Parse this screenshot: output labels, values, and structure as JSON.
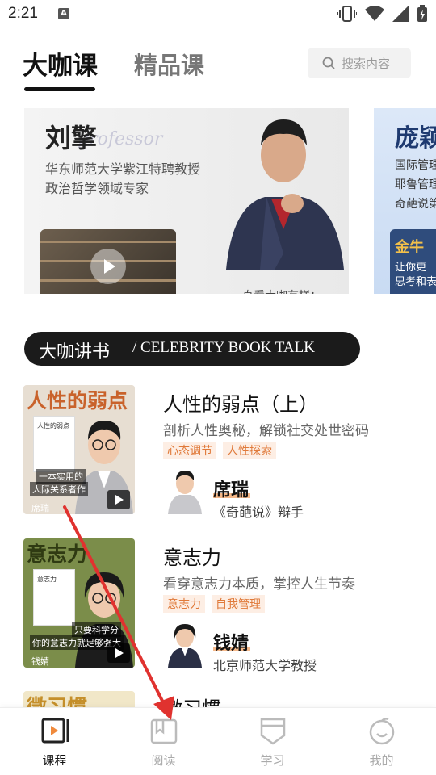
{
  "status_bar": {
    "time": "2:21",
    "notification_letter": "A"
  },
  "top_tabs": {
    "active_tab": "大咖课",
    "second_tab": "精品课",
    "search_placeholder": "搜索内容"
  },
  "banner_main": {
    "name": "刘擎",
    "watermark": "professor",
    "line1": "华东师范大学紫江特聘教授",
    "line2": "政治哲学领域专家",
    "caption": "直看大咖有样："
  },
  "banner_next": {
    "name": "庞颖",
    "line1": "国际管理",
    "line2": "耶鲁管理",
    "line3": "奇葩说第",
    "thumb_title": "金牛",
    "thumb_line1": "让你更",
    "thumb_line2": "思考和表"
  },
  "section": {
    "title_cn": "大咖讲书",
    "title_en": "/ CELEBRITY BOOK TALK"
  },
  "books": [
    {
      "cover_title": "人性的弱点",
      "cover_book_text": "人性的弱点",
      "cover_banner1": "一本实用的",
      "cover_banner2": "人际关系者作",
      "cover_author": "席瑞",
      "title": "人性的弱点（上）",
      "desc": "剖析人性奥秘，解锁社交处世密码",
      "tags": [
        "心态调节",
        "人性探索"
      ],
      "author": "席瑞",
      "role": "《奇葩说》辩手"
    },
    {
      "cover_title": "意志力",
      "cover_book_text": "意志力",
      "cover_banner1": "只要科学分",
      "cover_banner2": "你的意志力就足够强大",
      "cover_author": "钱婧",
      "title": "意志力",
      "desc": "看穿意志力本质，掌控人生节奏",
      "tags": [
        "意志力",
        "自我管理"
      ],
      "author": "钱婧",
      "role": "北京师范大学教授"
    },
    {
      "cover_title": "微习惯",
      "title": "微习惯"
    }
  ],
  "bottom_nav": [
    {
      "label": "课程",
      "icon": "course-icon",
      "active": true
    },
    {
      "label": "阅读",
      "icon": "book-icon",
      "active": false
    },
    {
      "label": "学习",
      "icon": "bookmark-shield-icon",
      "active": false
    },
    {
      "label": "我的",
      "icon": "profile-icon",
      "active": false
    }
  ],
  "colors": {
    "accent_orange": "#e07a3a",
    "annotation_red": "#e0322f"
  }
}
